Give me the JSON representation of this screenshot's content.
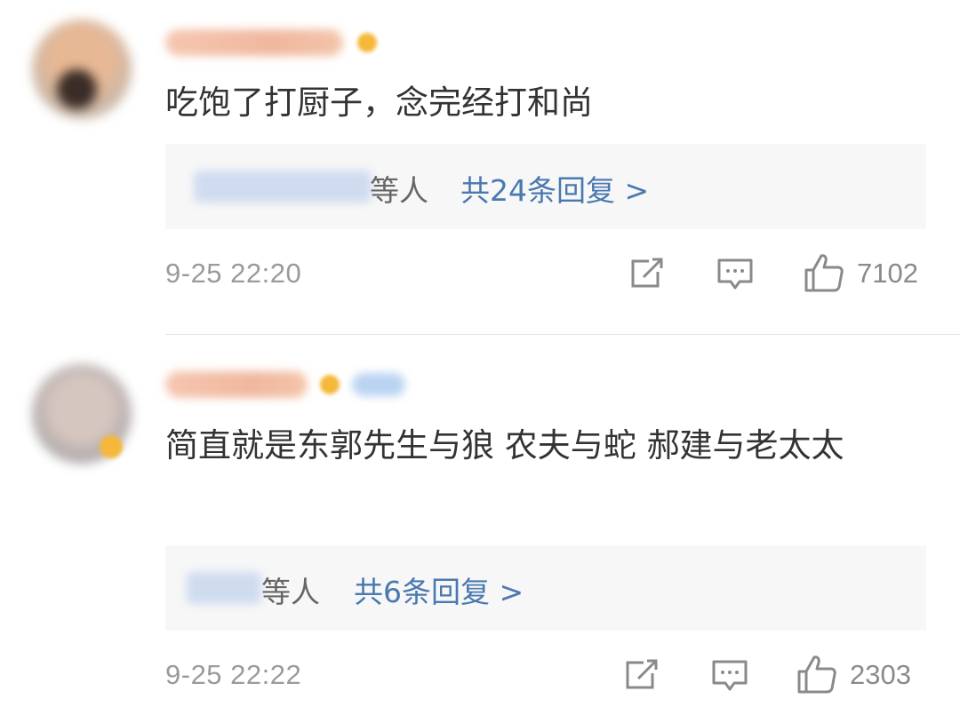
{
  "comments": [
    {
      "text": "吃饱了打厨子，念完经打和尚",
      "reply_suffix": "等人",
      "reply_link": "共24条回复 >",
      "time": "9-25 22:20",
      "likes": "7102"
    },
    {
      "text": "简直就是东郭先生与狼 农夫与蛇 郝建与老太太",
      "reply_suffix": "等人",
      "reply_link": "共6条回复 >",
      "time": "9-25 22:22",
      "likes": "2303"
    }
  ],
  "icons": {
    "share": "share-icon",
    "comment": "comment-icon",
    "like": "thumbs-up-icon"
  },
  "colors": {
    "text": "#333333",
    "link": "#4a78b0",
    "muted": "#9a9a9a",
    "reply_bg": "#f7f7f7"
  }
}
